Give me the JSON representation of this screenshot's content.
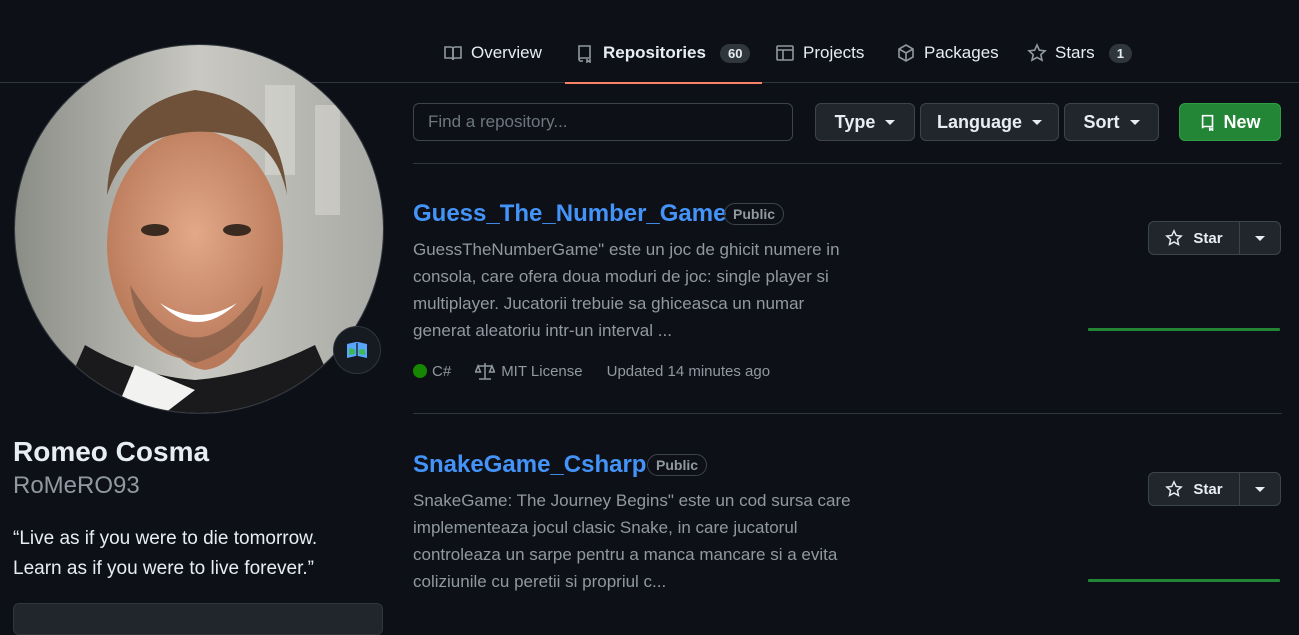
{
  "nav": {
    "tabs": [
      {
        "label": "Overview",
        "icon": "book-icon"
      },
      {
        "label": "Repositories",
        "icon": "repo-icon",
        "count": "60"
      },
      {
        "label": "Projects",
        "icon": "table-icon"
      },
      {
        "label": "Packages",
        "icon": "package-icon"
      },
      {
        "label": "Stars",
        "icon": "star-icon",
        "count": "1"
      }
    ]
  },
  "profile": {
    "name": "Romeo Cosma",
    "login": "RoMeRO93",
    "bio_line1": "“Live as if you were to die tomorrow.",
    "bio_line2": "Learn as if you were to live forever.”",
    "status_icon": "map-book-icon"
  },
  "filters": {
    "search_placeholder": "Find a repository...",
    "type_label": "Type",
    "language_label": "Language",
    "sort_label": "Sort",
    "new_label": "New"
  },
  "repos": [
    {
      "name": "Guess_The_Number_Game",
      "visibility": "Public",
      "description_lines": [
        "GuessTheNumberGame\" este un joc de ghicit numere in",
        "consola, care ofera doua moduri de joc: single player si",
        "multiplayer. Jucatorii trebuie sa ghiceasca un numar",
        "generat aleatoriu intr-un interval ..."
      ],
      "language": "C#",
      "language_color": "#178600",
      "license": "MIT License",
      "updated": "Updated 14 minutes ago",
      "star_label": "Star"
    },
    {
      "name": "SnakeGame_Csharp",
      "visibility": "Public",
      "description_lines": [
        "SnakeGame: The Journey Begins\" este un cod sursa care",
        "implementeaza jocul clasic Snake, in care jucatorul",
        "controleaza un sarpe pentru a manca mancare si a evita",
        "coliziunile cu peretii si propriul c..."
      ],
      "star_label": "Star"
    }
  ],
  "colors": {
    "link": "#4493f8",
    "accent_underline": "#f78166",
    "new_button": "#238636"
  }
}
